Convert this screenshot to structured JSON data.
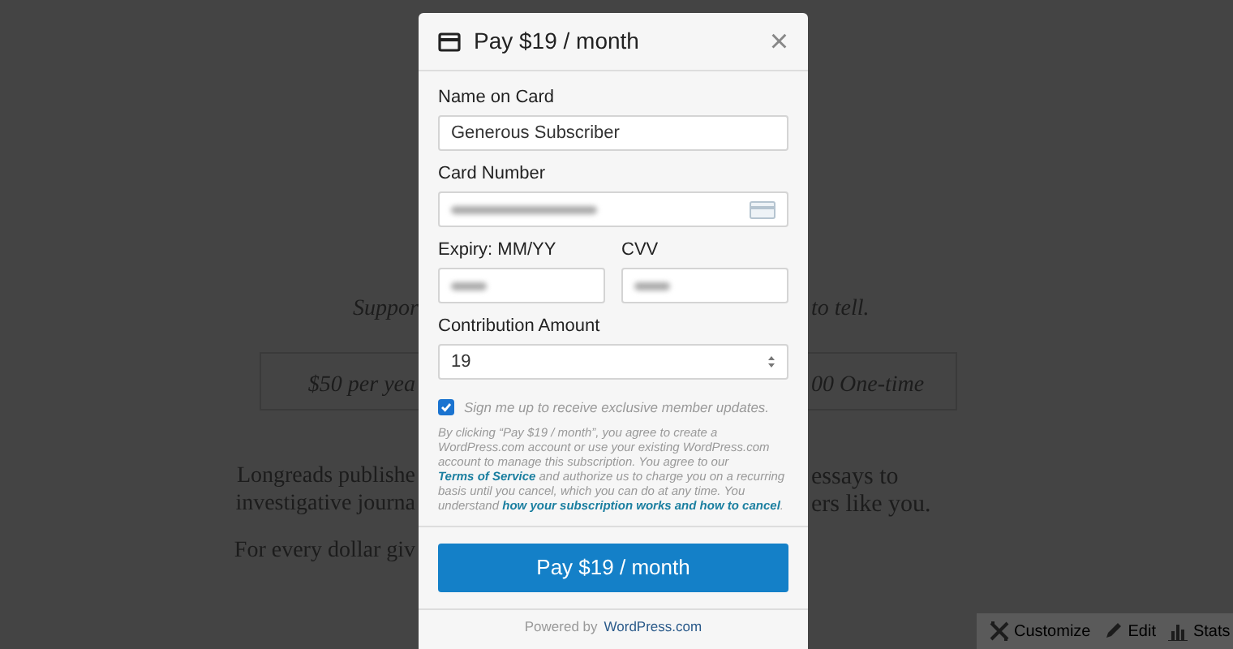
{
  "background_page": {
    "tagline_left": "Suppor",
    "tagline_right": "to tell.",
    "option_left": "$50 per yea",
    "option_right": "00 One-time",
    "paragraph_lines": [
      {
        "left": "Longreads publishe",
        "right": "essays to"
      },
      {
        "left": "investigative journa",
        "right": "ers like you."
      },
      {
        "left": "For every dollar giv"
      }
    ]
  },
  "admin_bar": [
    {
      "kind": "customize",
      "label": "Customize"
    },
    {
      "kind": "edit",
      "label": "Edit"
    },
    {
      "kind": "stats",
      "label": "Stats"
    }
  ],
  "modal": {
    "title": "Pay $19 / month",
    "close": "×",
    "field_rows": [
      [
        {
          "label": "Name on Card",
          "kind": "text",
          "value": "Generous Subscriber"
        }
      ],
      [
        {
          "label": "Card Number",
          "kind": "card"
        }
      ],
      [
        {
          "label": "Expiry: MM/YY",
          "kind": "blurred"
        },
        {
          "label": "CVV",
          "kind": "blurred"
        }
      ],
      [
        {
          "label": "Contribution Amount",
          "kind": "number",
          "value": "19"
        }
      ]
    ],
    "newsletter": {
      "label": "Sign me up to receive exclusive member updates.",
      "checked": true
    },
    "terms": [
      {
        "text": "By clicking “Pay $19 / month”, you agree to create a WordPress.com account or use your existing WordPress.com account to manage this subscription. You agree to our ",
        "link": false
      },
      {
        "text": "Terms of Service",
        "link": true
      },
      {
        "text": " and authorize us to charge you on a recurring basis until you cancel, which you can do at any time. You understand ",
        "link": false
      },
      {
        "text": "how your subscription works and how to cancel",
        "link": true
      },
      {
        "text": ".",
        "link": false
      }
    ],
    "pay_button": "Pay $19 / month",
    "footer": {
      "prefix": "Powered by",
      "link": "WordPress.com"
    }
  }
}
